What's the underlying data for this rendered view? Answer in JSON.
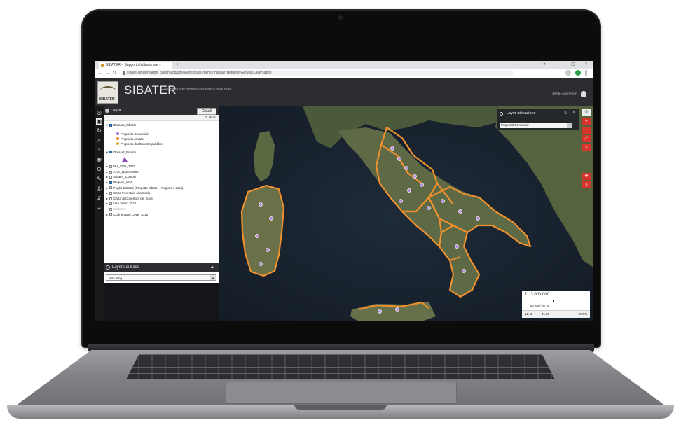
{
  "browser": {
    "tab_title": "SIBATER – Supporto Istituzionale ×",
    "tab_close": "×",
    "new_tab": "+",
    "window_controls": [
      "●",
      "–",
      "▢",
      "×"
    ],
    "nav": {
      "back": "←",
      "forward": "→",
      "reload": "↻"
    },
    "url": "sibater.gov.it/mappe_banche/bg/sgeoweb/sibater/demo/mappa/?request=GetMapLayers&title"
  },
  "app": {
    "title": "SIBATER",
    "subtitle": "Supporto Istituzionale alla Banca delle terre",
    "user_label": "Utente connesso"
  },
  "toolbar": {
    "icons": [
      "layers-icon",
      "info-icon",
      "refresh-icon",
      "search-icon",
      "pin-icon",
      "globe-icon",
      "ruler-icon",
      "edit-icon",
      "print-icon",
      "wrench-icon",
      "list-icon"
    ]
  },
  "layers_panel": {
    "title": "Layer",
    "close_label": "Chiudi",
    "mini_tools": "✎  ⊕  ⊖",
    "groups": [
      {
        "label": "Dataset_Sibater",
        "checked": true,
        "expanded": true
      },
      {
        "label": "Dataset_Esterni",
        "checked": true,
        "expanded": true
      }
    ],
    "legend_sibater": [
      {
        "label": "Proprietà Demaniali",
        "color": "#a86ed6"
      },
      {
        "label": "Proprietà private",
        "color": "#f08a24"
      },
      {
        "label": "Proprietà di altro ente pubblico",
        "color": "#d9b02a"
      }
    ],
    "other_layers": [
      {
        "label": "NV_SIPA_2021",
        "checked": false
      },
      {
        "label": "Aree_Natura2000",
        "checked": false
      },
      {
        "label": "Sibater_Comuni",
        "checked": false
      },
      {
        "label": "Regioni_Istat",
        "checked": true
      },
      {
        "label": "Foglio Catasto (Progetto Sibater - Regioni e Italia)",
        "checked": false
      },
      {
        "label": "Carta Forestale Alta Scala",
        "checked": false
      },
      {
        "label": "Carta di Copertura del Suolo",
        "checked": false
      },
      {
        "label": "Uso Suolo 2018",
        "checked": false
      },
      {
        "label": "Cadastre",
        "checked": false,
        "greyed": true
      },
      {
        "label": "Corine Land Cover 2018",
        "checked": false
      }
    ],
    "base_layers_title": "Layers di base",
    "base_layer_selected": "Map Bing"
  },
  "map": {
    "popup_title": "Layer attivazione",
    "popup_select": "Proprietà Demaniali",
    "scale": "1 : 3.000.000",
    "scale_unit": "50 km / 50 mi",
    "coord_x": "12.45",
    "coord_y": "41.90",
    "crs": "EPSG"
  },
  "colors": {
    "boundary": "#f0912d",
    "marker_public": "#b58be0",
    "app_header": "#2b2d31"
  }
}
